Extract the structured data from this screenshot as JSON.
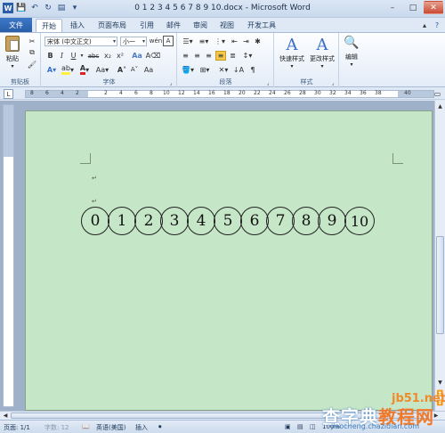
{
  "titlebar": {
    "title": "0 1 2 3 4 5 6 7 8 9 10.docx - Microsoft Word",
    "minimize": "–",
    "maximize": "□",
    "close": "✕"
  },
  "tabs": {
    "file": "文件",
    "items": [
      "开始",
      "插入",
      "页面布局",
      "引用",
      "邮件",
      "审阅",
      "视图",
      "开发工具"
    ]
  },
  "ribbon": {
    "clipboard": {
      "paste": "粘贴",
      "label": "剪贴板"
    },
    "font": {
      "name": "宋体 (中文正文)",
      "size": "小一",
      "label": "字体",
      "bold": "B",
      "italic": "I",
      "underline": "U",
      "strike": "abc",
      "sub": "x₂",
      "sup": "x²"
    },
    "paragraph": {
      "label": "段落"
    },
    "styles": {
      "quick": "快速样式",
      "change": "更改样式",
      "label": "样式"
    },
    "editing": {
      "label": "编辑"
    }
  },
  "ruler": {
    "numbers": [
      "8",
      "6",
      "4",
      "2",
      "2",
      "4",
      "6",
      "8",
      "10",
      "12",
      "14",
      "16",
      "18",
      "20",
      "22",
      "24",
      "26",
      "28",
      "30",
      "32",
      "34",
      "36",
      "38",
      "40"
    ]
  },
  "document": {
    "circled_numbers": [
      "0",
      "1",
      "2",
      "3",
      "4",
      "5",
      "6",
      "7",
      "8",
      "9",
      "10"
    ],
    "para_mark": "↵"
  },
  "statusbar": {
    "page": "页面: 1/1",
    "words": "字数: 12",
    "language": "英语(美国)",
    "mode": "插入",
    "zoom": "100%"
  },
  "watermark": {
    "line1": "查字典",
    "line2": "教程网",
    "site": "jb51.net",
    "sub": "jiaocheng.chazidian.com",
    "domain": "jiaocheng.chazidian.com"
  },
  "colors": {
    "page_bg": "#c6e6c8",
    "file_tab": "#2a5ea8",
    "workspace": "#9fb1c9"
  }
}
